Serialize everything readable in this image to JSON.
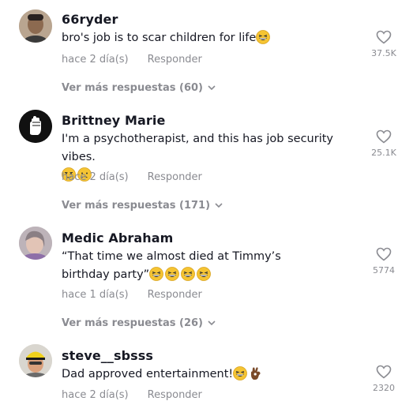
{
  "comments": [
    {
      "username": "66ryder",
      "text": "bro's job is to scar children for life",
      "emojis": [
        "laughing-emoji"
      ],
      "time": "hace 2 día(s)",
      "reply_label": "Responder",
      "likes": "37.5K",
      "more_replies": "Ver más respuestas (60)"
    },
    {
      "username": "Brittney Marie",
      "text": "I'm a psychotherapist, and this has job security vibes.",
      "emojis": [
        "smirk-emoji",
        "worried-emoji"
      ],
      "time": "hace 2 día(s)",
      "reply_label": "Responder",
      "likes": "25.1K",
      "more_replies": "Ver más respuestas (171)"
    },
    {
      "username": "Medic Abraham",
      "text": "“That time we almost died at Timmy’s birthday party”",
      "emojis": [
        "laughing-emoji",
        "laughing-emoji",
        "laughing-emoji",
        "laughing-emoji"
      ],
      "time": "hace 1 día(s)",
      "reply_label": "Responder",
      "likes": "5774",
      "more_replies": "Ver más respuestas (26)"
    },
    {
      "username": "steve__sbsss",
      "text": "Dad approved entertainment!",
      "emojis": [
        "laughing-emoji",
        "ok-hand-emoji"
      ],
      "time": "hace 2 día(s)",
      "reply_label": "Responder",
      "likes": "2320"
    }
  ],
  "colors": {
    "text": "#161823",
    "muted": "#8a8b91",
    "emoji": "#f5c433"
  }
}
